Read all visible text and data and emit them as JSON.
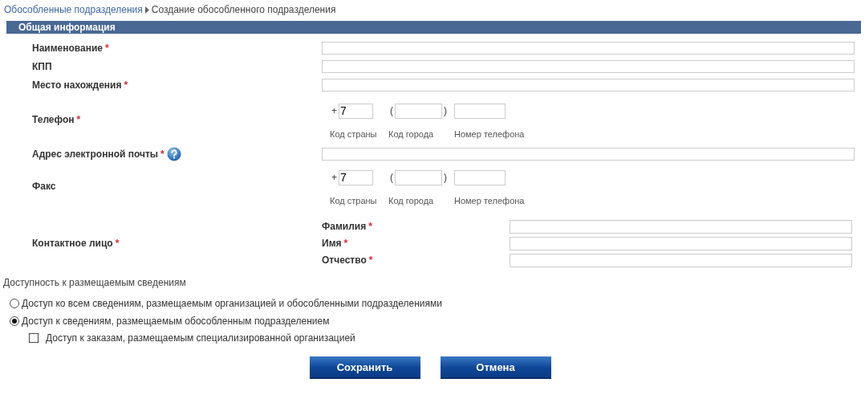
{
  "breadcrumb": [
    {
      "text": "Обособленные подразделения",
      "link": true
    },
    {
      "text": "Создание обособленного подразделения",
      "link": false
    }
  ],
  "required_mark": "*",
  "section": {
    "title": "Общая информация"
  },
  "fields": [
    {
      "kind": "text",
      "label": "Наименование",
      "required": true,
      "help": false
    },
    {
      "kind": "text",
      "label": "КПП",
      "required": false,
      "help": false
    },
    {
      "kind": "text",
      "label": "Место нахождения",
      "required": true,
      "help": false
    },
    {
      "kind": "phone",
      "label": "Телефон",
      "required": true,
      "help": false,
      "prefix": "+",
      "country_code": "7",
      "open": "(",
      "close": ")",
      "captions": [
        "Код страны",
        "Код города",
        "Номер телефона"
      ]
    },
    {
      "kind": "text",
      "label": "Адрес электронной почты",
      "required": true,
      "help": true
    },
    {
      "kind": "phone",
      "label": "Факс",
      "required": false,
      "help": false,
      "prefix": "+",
      "country_code": "7",
      "open": "(",
      "close": ")",
      "captions": [
        "Код страны",
        "Код города",
        "Номер телефона"
      ]
    },
    {
      "kind": "contact",
      "label": "Контактное лицо",
      "required": true,
      "help": false,
      "parts": [
        {
          "label": "Фамилия",
          "required": true
        },
        {
          "label": "Имя",
          "required": true
        },
        {
          "label": "Отчество",
          "required": true
        }
      ]
    }
  ],
  "access": {
    "title": "Доступность к размещаемым сведениям",
    "options": [
      {
        "label": "Доступ ко всем сведениям, размещаемым организацией и обособленными подразделениями",
        "selected": false
      },
      {
        "label": "Доступ к сведениям, размещаемым обособленным подразделением",
        "selected": true
      }
    ],
    "checkbox": {
      "label": "Доступ к заказам, размещаемым специализированной организацией",
      "checked": false
    }
  },
  "buttons": [
    "Сохранить",
    "Отмена"
  ]
}
